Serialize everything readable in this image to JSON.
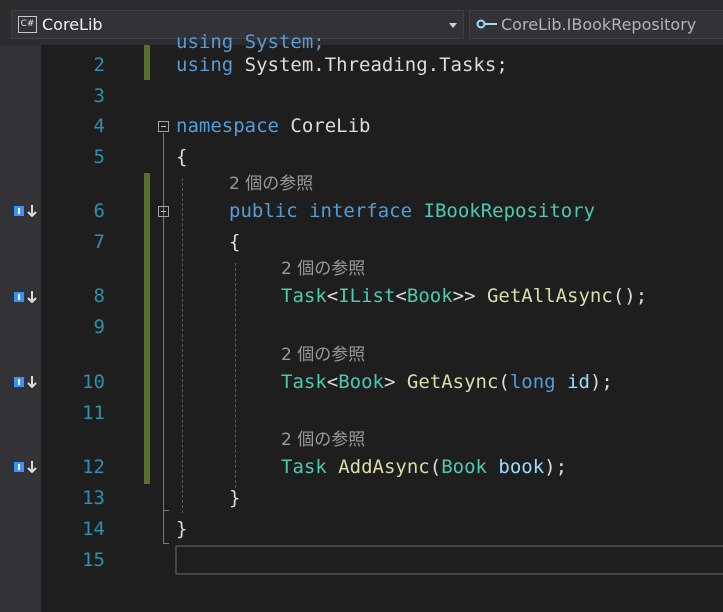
{
  "navbar": {
    "left_icon_label": "C#",
    "left_combo": "CoreLib",
    "right_combo": "CoreLib.IBookRepository"
  },
  "colors": {
    "keyword": "#569cd6",
    "type": "#4ec9b0",
    "method": "#dcdcaa",
    "parameter": "#9cdcfe",
    "line_number": "#2b91af",
    "codelens": "#999999",
    "change_bar": "#57712d"
  },
  "editor": {
    "line_numbers": [
      "2",
      "3",
      "4",
      "5",
      "6",
      "7",
      "8",
      "9",
      "10",
      "11",
      "12",
      "13",
      "14",
      "15"
    ],
    "codelens": "2 個の参照",
    "code": {
      "l1_partial": "using System;",
      "l2_using": "using",
      "l2_ns": "System.Threading.Tasks;",
      "l4_kw": "namespace",
      "l4_name": "CoreLib",
      "open_brace": "{",
      "close_brace": "}",
      "l6_public": "public",
      "l6_interface": "interface",
      "l6_name": "IBookRepository",
      "task": "Task",
      "lt": "<",
      "ilist": "IList",
      "book": "Book",
      "gt2": ">>",
      "gt": ">",
      "space": " ",
      "get_all": "GetAllAsync",
      "call_end": "();",
      "get_async": "GetAsync",
      "paren_open": "(",
      "long_kw": "long",
      "id_param": "id",
      "paren_end": ");",
      "add_async": "AddAsync",
      "book_param": "book"
    }
  }
}
